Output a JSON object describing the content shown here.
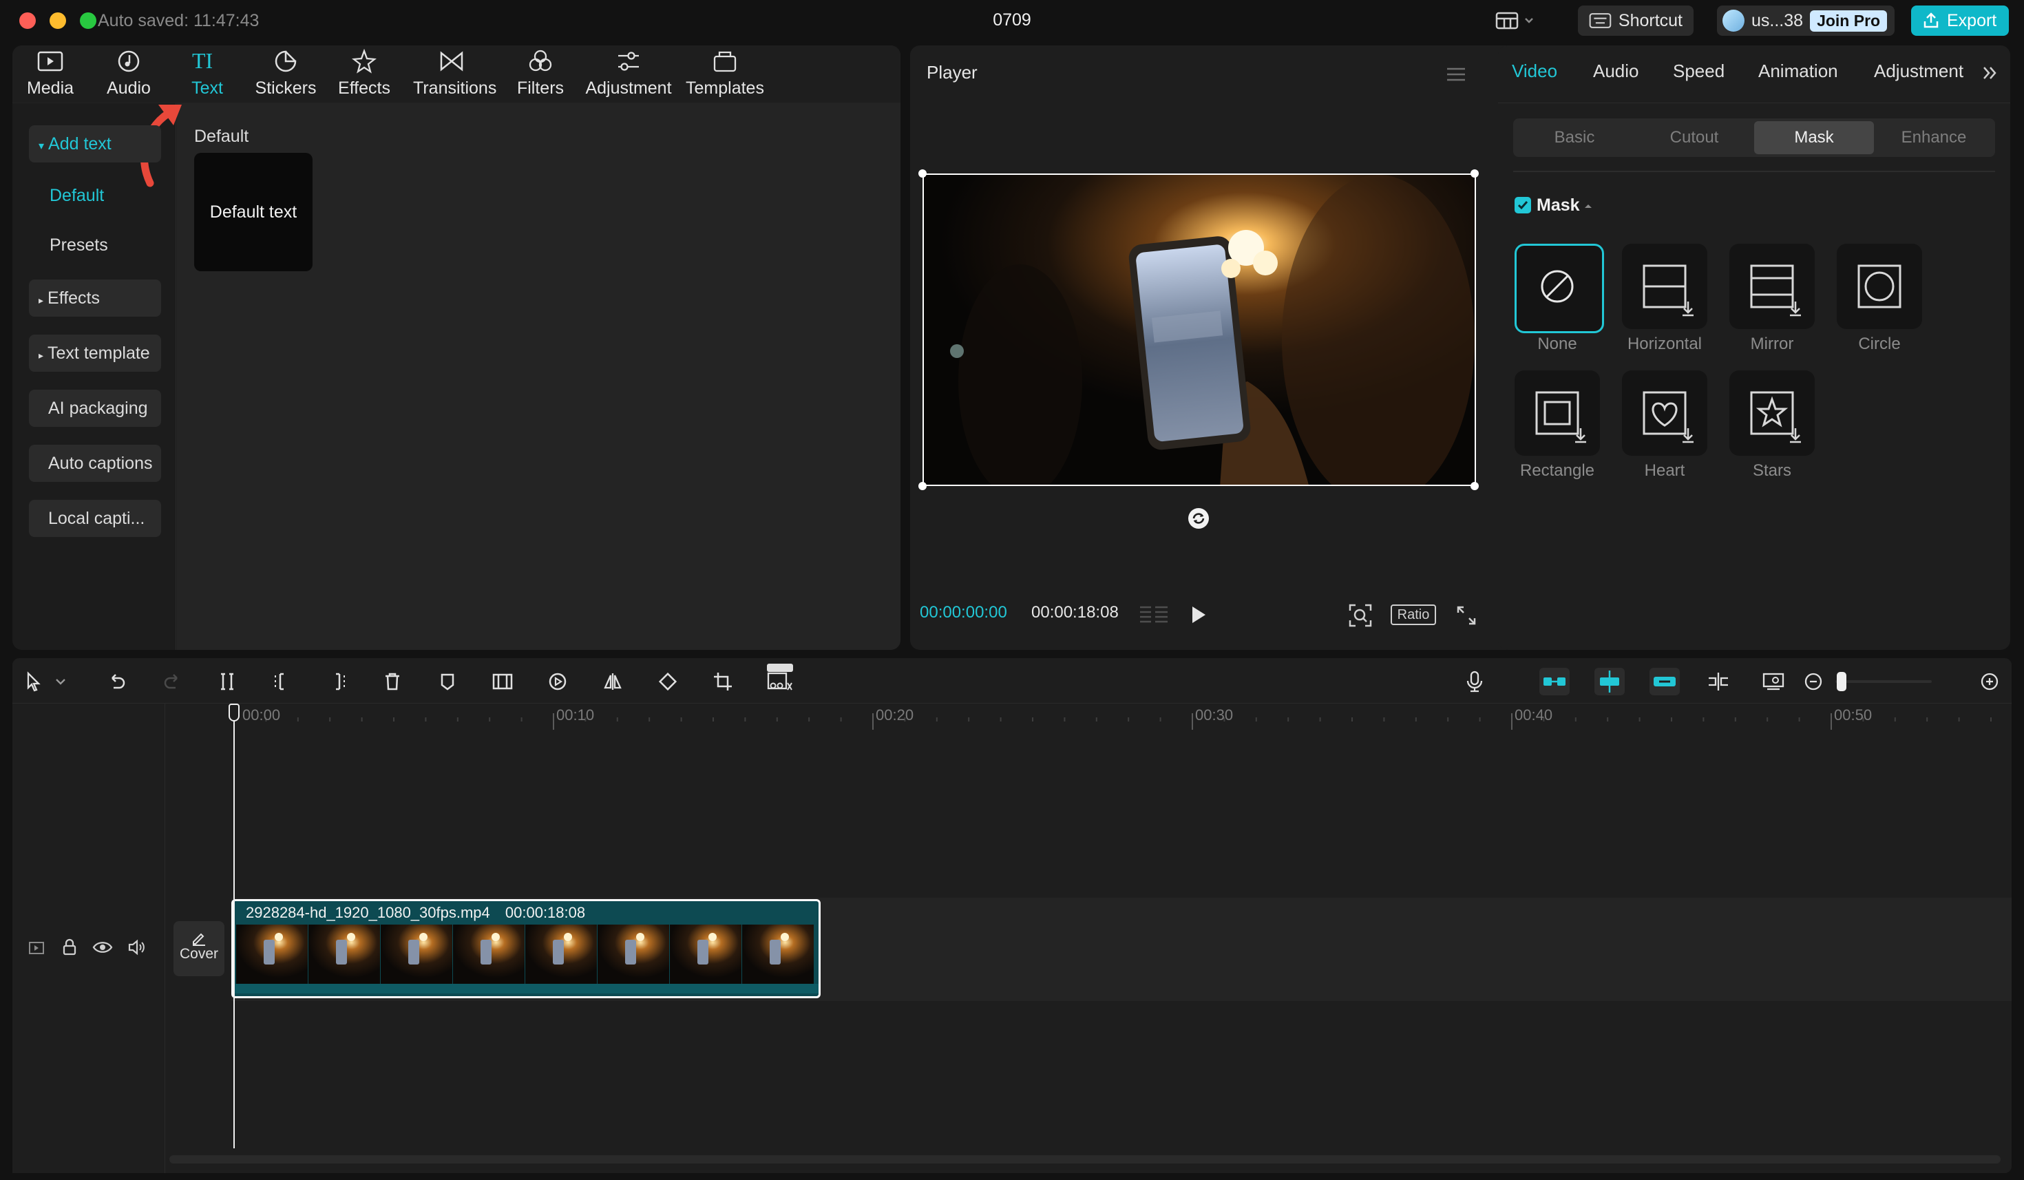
{
  "titlebar": {
    "autosave": "Auto saved: 11:47:43",
    "project_name": "0709",
    "shortcut_label": "Shortcut",
    "user_label": "us...38",
    "join_pro_label": "Join Pro",
    "export_label": "Export"
  },
  "media_tabs": [
    {
      "label": "Media",
      "icon": "media-icon"
    },
    {
      "label": "Audio",
      "icon": "audio-icon"
    },
    {
      "label": "Text",
      "icon": "text-icon",
      "active": true
    },
    {
      "label": "Stickers",
      "icon": "stickers-icon"
    },
    {
      "label": "Effects",
      "icon": "effects-icon"
    },
    {
      "label": "Transitions",
      "icon": "transitions-icon"
    },
    {
      "label": "Filters",
      "icon": "filters-icon"
    },
    {
      "label": "Adjustment",
      "icon": "adjustment-icon"
    },
    {
      "label": "Templates",
      "icon": "templates-icon"
    }
  ],
  "text_sidebar": {
    "add_text": "Add text",
    "default": "Default",
    "presets": "Presets",
    "effects": "Effects",
    "text_template": "Text template",
    "ai_packaging": "AI packaging",
    "auto_captions": "Auto captions",
    "local_captions": "Local capti..."
  },
  "text_content": {
    "section_title": "Default",
    "card_label": "Default text"
  },
  "player": {
    "title": "Player",
    "current_time": "00:00:00:00",
    "duration": "00:00:18:08",
    "ratio_label": "Ratio"
  },
  "inspector": {
    "tabs": [
      "Video",
      "Audio",
      "Speed",
      "Animation",
      "Adjustment"
    ],
    "active_tab": "Video",
    "subtabs": [
      "Basic",
      "Cutout",
      "Mask",
      "Enhance"
    ],
    "active_subtab": "Mask",
    "mask_label": "Mask",
    "mask_checked": true,
    "masks": [
      {
        "label": "None",
        "icon": "none-icon",
        "selected": true
      },
      {
        "label": "Horizontal",
        "icon": "horizontal-mask-icon"
      },
      {
        "label": "Mirror",
        "icon": "mirror-mask-icon"
      },
      {
        "label": "Circle",
        "icon": "circle-mask-icon"
      },
      {
        "label": "Rectangle",
        "icon": "rectangle-mask-icon"
      },
      {
        "label": "Heart",
        "icon": "heart-mask-icon"
      },
      {
        "label": "Stars",
        "icon": "stars-mask-icon"
      }
    ]
  },
  "timeline": {
    "ruler": [
      "00:00",
      "00:10",
      "00:20",
      "00:30",
      "00:40",
      "00:50"
    ],
    "clip_name": "2928284-hd_1920_1080_30fps.mp4",
    "clip_duration": "00:00:18:08",
    "cover_label": "Cover"
  },
  "colors": {
    "accent": "#22c7d6",
    "export_bg": "#0fb8c9",
    "arrow": "#e8483a",
    "clip_bg": "#0d4a52"
  }
}
